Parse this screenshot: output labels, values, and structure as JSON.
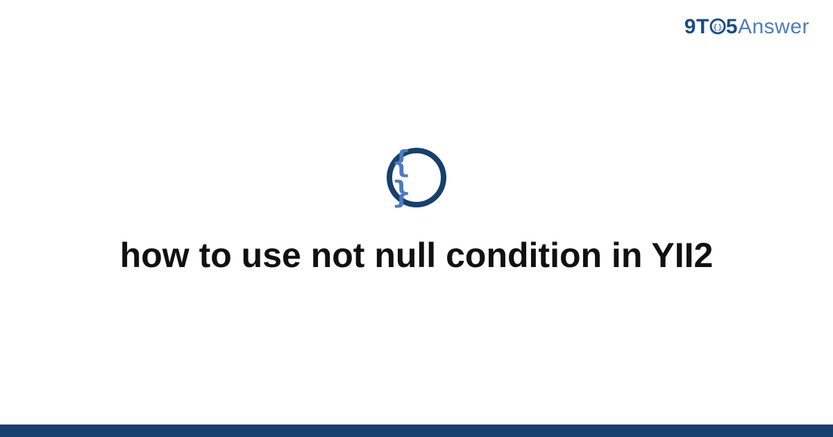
{
  "brand": {
    "part_nine": "9",
    "part_t": "T",
    "part_five": "5",
    "part_answer": "Answer"
  },
  "icon": {
    "braces": "{ }"
  },
  "title": "how to use not null condition in YII2",
  "colors": {
    "dark_blue": "#17406e",
    "mid_blue": "#1a4b8c",
    "light_blue": "#4a7bc4"
  }
}
